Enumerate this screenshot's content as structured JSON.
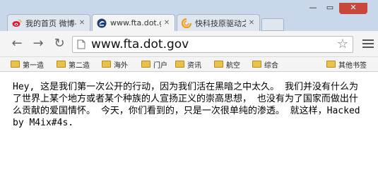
{
  "tabs": [
    {
      "label": "我的首页 微博-",
      "icon": "weibo-icon",
      "active": false
    },
    {
      "label": "www.fta.dot.go",
      "icon": "fta-logo-icon",
      "active": true
    },
    {
      "label": "快科技原驱动之",
      "icon": "kkj-icon",
      "active": false
    }
  ],
  "address_bar": {
    "url": "www.fta.dot.gov"
  },
  "bookmarks": [
    "第一造",
    "第二造",
    "海外",
    "门户",
    "资讯",
    "航空",
    "综合"
  ],
  "other_bookmarks": "其他书签",
  "page": {
    "text": "Hey, 这是我们第一次公开的行动，因为我们活在黑暗之中太久。 我们并没有什么为了世界上某个地方或者某个种族的人宣扬正义的崇高思想， 也没有为了国家而做出什么贡献的爱国情怀。 今天，你们看到的，只是一次很单纯的渗透。 就这样，Hacked by M4ix#4s."
  },
  "colors": {
    "titlebar": "#c8d7ea",
    "close_button": "#c9463d"
  }
}
